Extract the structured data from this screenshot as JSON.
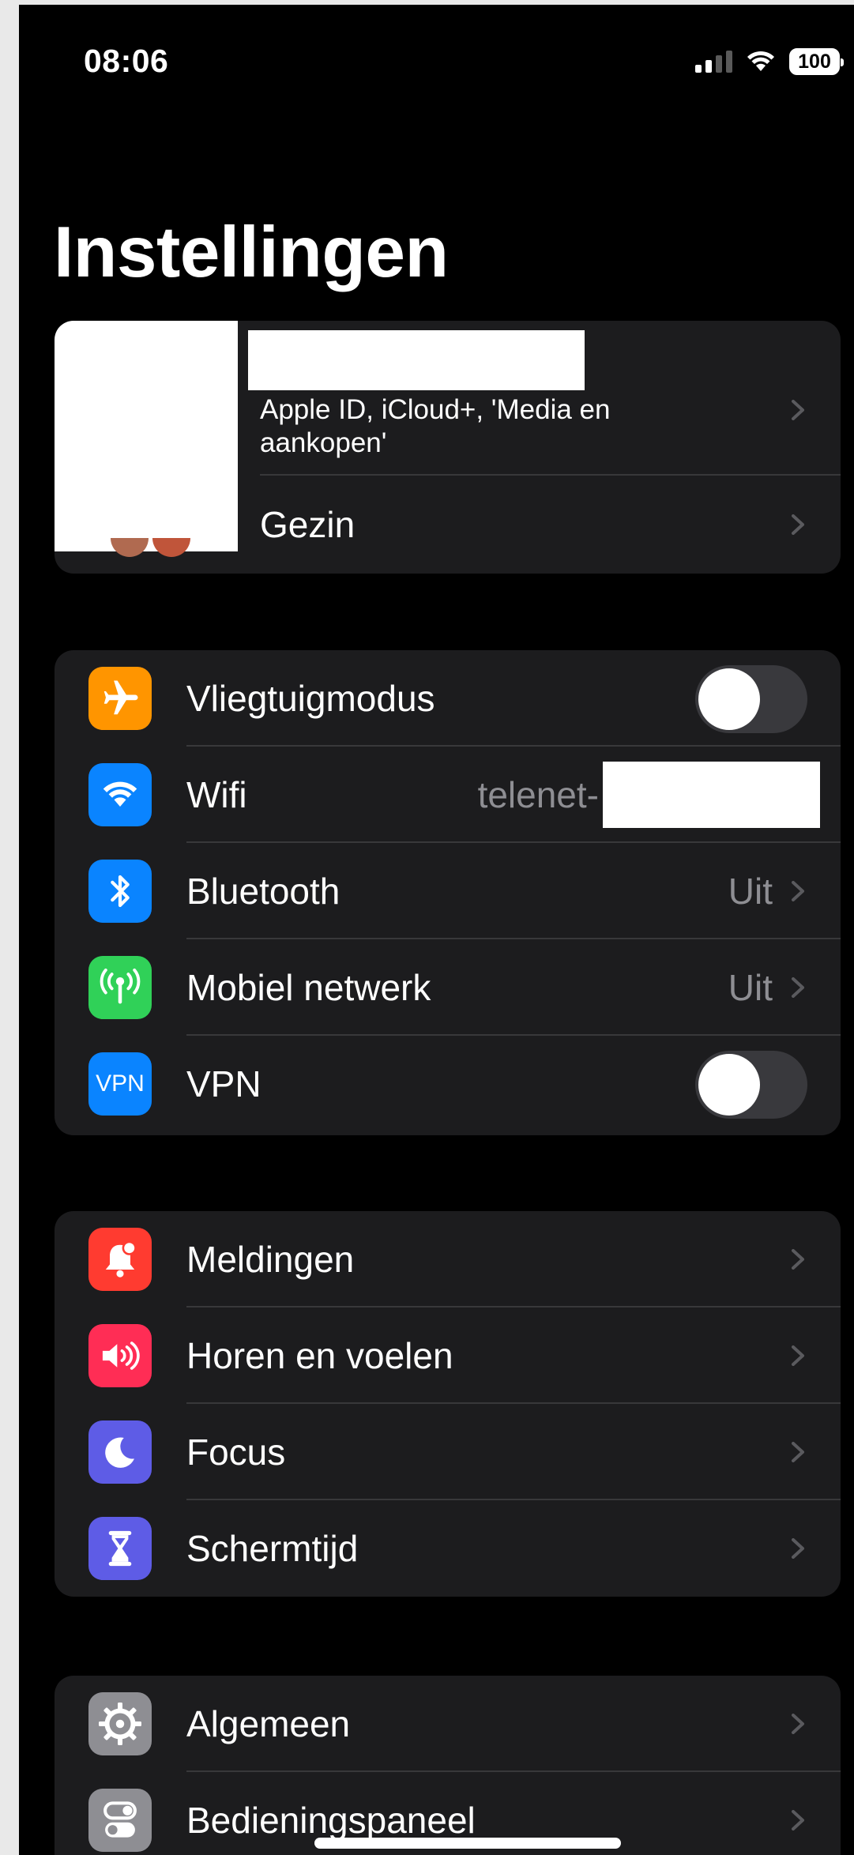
{
  "status_bar": {
    "time": "08:06",
    "battery_percent": "100",
    "signal_bars_active": 2,
    "signal_bars_total": 4
  },
  "page_title": "Instellingen",
  "profile": {
    "subtitle": "Apple ID, iCloud+, 'Media en aankopen'",
    "family_label": "Gezin"
  },
  "connectivity": [
    {
      "id": "airplane",
      "label": "Vliegtuigmodus",
      "icon": "airplane-icon",
      "color": "#ff9500",
      "control": "toggle",
      "on": false
    },
    {
      "id": "wifi",
      "label": "Wifi",
      "icon": "wifi-icon",
      "color": "#0a84ff",
      "value": "telenet-",
      "control": "redacted"
    },
    {
      "id": "bluetooth",
      "label": "Bluetooth",
      "icon": "bluetooth-icon",
      "color": "#0a84ff",
      "value": "Uit",
      "control": "chevron"
    },
    {
      "id": "cellular",
      "label": "Mobiel netwerk",
      "icon": "antenna-icon",
      "color": "#30d158",
      "value": "Uit",
      "control": "chevron"
    },
    {
      "id": "vpn",
      "label": "VPN",
      "icon": "vpn-icon",
      "icon_text": "VPN",
      "color": "#0a84ff",
      "control": "toggle",
      "on": false
    }
  ],
  "notifications_group": [
    {
      "id": "notifications",
      "label": "Meldingen",
      "icon": "bell-icon",
      "color": "#ff3b30"
    },
    {
      "id": "sounds",
      "label": "Horen en voelen",
      "icon": "speaker-icon",
      "color": "#ff2d55"
    },
    {
      "id": "focus",
      "label": "Focus",
      "icon": "moon-icon",
      "color": "#5e5ce6"
    },
    {
      "id": "screentime",
      "label": "Schermtijd",
      "icon": "hourglass-icon",
      "color": "#5e5ce6"
    }
  ],
  "general_group": [
    {
      "id": "general",
      "label": "Algemeen",
      "icon": "gear-icon",
      "color": "#8e8e93"
    },
    {
      "id": "control_center",
      "label": "Bedieningspaneel",
      "icon": "switches-icon",
      "color": "#8e8e93"
    }
  ]
}
